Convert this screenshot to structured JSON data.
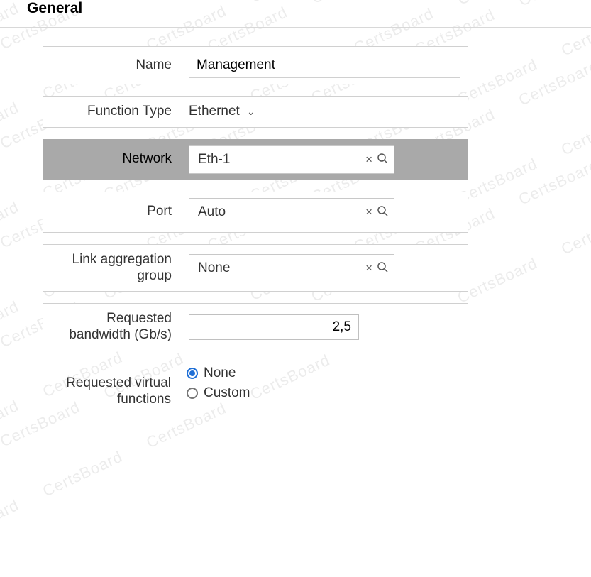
{
  "section": {
    "title": "General"
  },
  "watermark": {
    "text": "CertsBoard"
  },
  "fields": {
    "name": {
      "label": "Name",
      "value": "Management"
    },
    "function_type": {
      "label": "Function Type",
      "value": "Ethernet"
    },
    "network": {
      "label": "Network",
      "value": "Eth-1"
    },
    "port": {
      "label": "Port",
      "value": "Auto"
    },
    "lag": {
      "label": "Link aggregation group",
      "value": "None"
    },
    "bandwidth": {
      "label": "Requested bandwidth (Gb/s)",
      "value": "2,5"
    },
    "virtual_fns": {
      "label": "Requested virtual functions",
      "options": {
        "none": "None",
        "custom": "Custom"
      },
      "selected": "none"
    }
  },
  "icons": {
    "clear": "×",
    "chevron": "⌄"
  }
}
